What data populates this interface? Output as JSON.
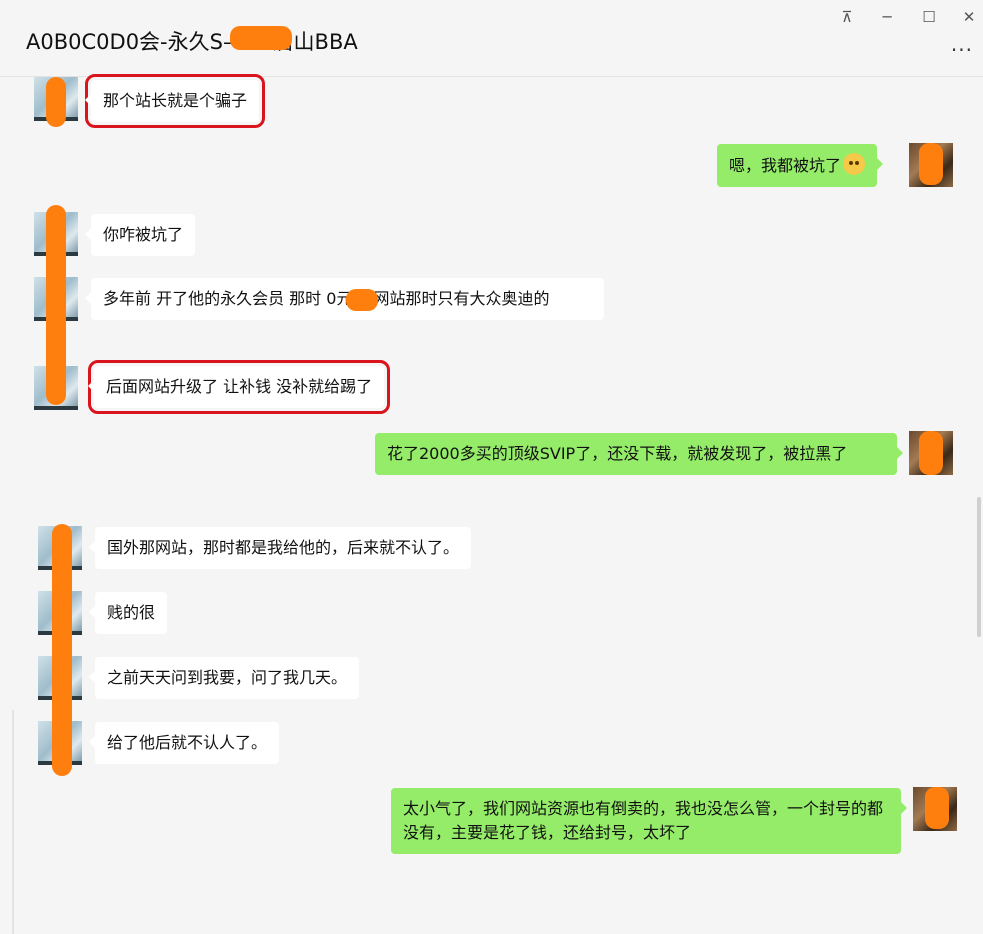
{
  "window": {
    "title": "A0B0C0D0会-永久S——-眉山BBA",
    "controls": {
      "pin": "⊼",
      "minimize": "─",
      "maximize": "☐",
      "close": "✕"
    },
    "more": "···"
  },
  "messages": [
    {
      "side": "left",
      "text": "那个站长就是个骗子",
      "highlighted": true
    },
    {
      "side": "right",
      "text": "嗯，我都被坑了",
      "emoji": "crying-face"
    },
    {
      "side": "left",
      "text": "你咋被坑了"
    },
    {
      "side": "left",
      "text": "多年前 开了他的永久会员  那时   0元  他网站那时只有大众奥迪的"
    },
    {
      "side": "left",
      "text": "后面网站升级了 让补钱  没补就给踢了",
      "highlighted": true
    },
    {
      "side": "right",
      "text": "花了2000多买的顶级SVIP了，还没下载，就被发现了，被拉黑了"
    },
    {
      "side": "left",
      "text": "国外那网站，那时都是我给他的，后来就不认了。"
    },
    {
      "side": "left",
      "text": "贱的很"
    },
    {
      "side": "left",
      "text": "之前天天问到我要，问了我几天。"
    },
    {
      "side": "left",
      "text": "给了他后就不认人了。"
    },
    {
      "side": "right",
      "text": "太小气了，我们网站资源也有倒卖的，我也没怎么管，一个封号的都没有，主要是花了钱，还给封号，太坏了"
    }
  ],
  "colors": {
    "self_bubble": "#95ec69",
    "other_bubble": "#ffffff",
    "highlight": "#d9141c",
    "redaction": "#ff7f0e"
  }
}
